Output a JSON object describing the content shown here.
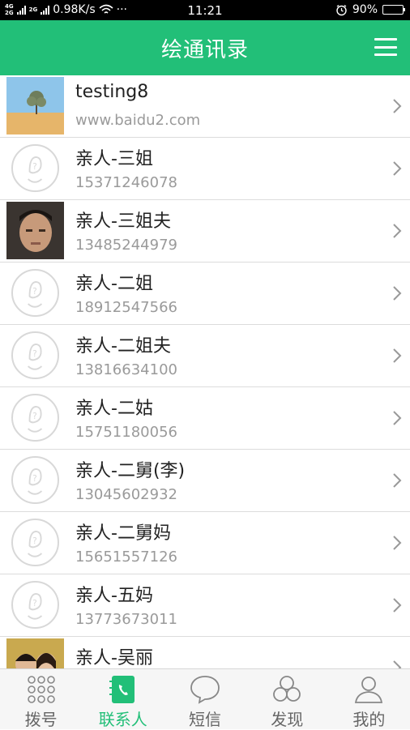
{
  "status_bar": {
    "network_tag_top": "4G",
    "network_tag_bottom": "2G",
    "network_tag_2": "2G",
    "speed": "0.98K/s",
    "more": "···",
    "time": "11:21",
    "battery_percent": "90%",
    "battery_level": 0.9
  },
  "header": {
    "title": "绘通讯录",
    "menu_icon": "menu-icon"
  },
  "contacts": [
    {
      "name": "testing8",
      "sub": "www.baidu2.com",
      "avatar": "photo-tree"
    },
    {
      "name": "亲人-三姐",
      "sub": "15371246078",
      "avatar": "default"
    },
    {
      "name": "亲人-三姐夫",
      "sub": "13485244979",
      "avatar": "photo-man"
    },
    {
      "name": "亲人-二姐",
      "sub": "18912547566",
      "avatar": "default"
    },
    {
      "name": "亲人-二姐夫",
      "sub": "13816634100",
      "avatar": "default"
    },
    {
      "name": "亲人-二姑",
      "sub": "15751180056",
      "avatar": "default"
    },
    {
      "name": "亲人-二舅(李)",
      "sub": "13045602932",
      "avatar": "default"
    },
    {
      "name": "亲人-二舅妈",
      "sub": "15651557126",
      "avatar": "default"
    },
    {
      "name": "亲人-五妈",
      "sub": "13773673011",
      "avatar": "default"
    },
    {
      "name": "亲人-吴丽",
      "sub": "",
      "avatar": "photo-couple"
    }
  ],
  "tabs": [
    {
      "label": "拨号",
      "icon": "dialpad-icon",
      "active": false
    },
    {
      "label": "联系人",
      "icon": "contacts-book-icon",
      "active": true
    },
    {
      "label": "短信",
      "icon": "message-bubble-icon",
      "active": false
    },
    {
      "label": "发现",
      "icon": "discover-circles-icon",
      "active": false
    },
    {
      "label": "我的",
      "icon": "profile-icon",
      "active": false
    }
  ],
  "colors": {
    "brand": "#22bf78",
    "text": "#222222",
    "subtext": "#9a9a9a"
  }
}
